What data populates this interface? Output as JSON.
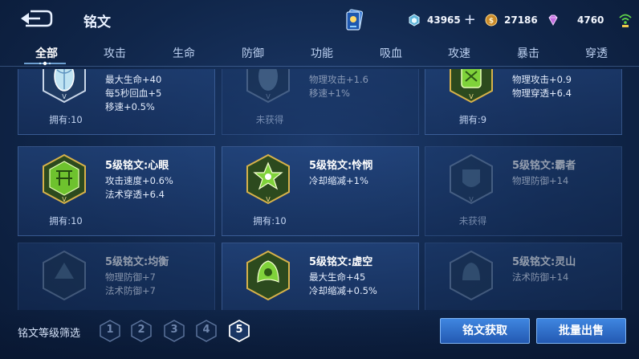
{
  "header": {
    "title": "铭文",
    "currency": [
      {
        "icon": "hex-coin-icon",
        "value": "43965"
      },
      {
        "icon": "gold-coin-icon",
        "value": "27186"
      },
      {
        "icon": "diamond-icon",
        "value": "4760"
      }
    ]
  },
  "tabs": [
    "全部",
    "攻击",
    "生命",
    "防御",
    "功能",
    "吸血",
    "攻速",
    "暴击",
    "穿透"
  ],
  "cards": [
    {
      "name": "",
      "stats": [
        "最大生命+40",
        "每5秒回血+5",
        "移速+0.5%"
      ],
      "owned": "拥有:10",
      "locked": false
    },
    {
      "name": "",
      "stats": [
        "物理攻击+1.6",
        "移速+1%",
        ""
      ],
      "owned": "未获得",
      "locked": true
    },
    {
      "name": "",
      "stats": [
        "物理攻击+0.9",
        "物理穿透+6.4",
        ""
      ],
      "owned": "拥有:9",
      "locked": false
    },
    {
      "name": "5级铭文:心眼",
      "stats": [
        "攻击速度+0.6%",
        "法术穿透+6.4",
        ""
      ],
      "owned": "拥有:10",
      "locked": false
    },
    {
      "name": "5级铭文:怜悯",
      "stats": [
        "冷却缩减+1%",
        "",
        ""
      ],
      "owned": "拥有:10",
      "locked": false
    },
    {
      "name": "5级铭文:霸者",
      "stats": [
        "物理防御+14",
        "",
        ""
      ],
      "owned": "未获得",
      "locked": true
    },
    {
      "name": "5级铭文:均衡",
      "stats": [
        "物理防御+7",
        "法术防御+7",
        ""
      ],
      "owned": "",
      "locked": true
    },
    {
      "name": "5级铭文:虚空",
      "stats": [
        "最大生命+45",
        "冷却缩减+0.5%",
        ""
      ],
      "owned": "",
      "locked": false
    },
    {
      "name": "5级铭文:灵山",
      "stats": [
        "法术防御+14",
        "",
        ""
      ],
      "owned": "",
      "locked": true
    }
  ],
  "footer": {
    "filter_label": "铭文等级筛选",
    "levels": [
      "1",
      "2",
      "3",
      "4",
      "5"
    ],
    "acquire_button": "铭文获取",
    "sell_button": "批量出售"
  },
  "colors": {
    "accent": "#2f6fcf",
    "active_tab": "#ffffff",
    "icon_green": "#7fd23a",
    "icon_gold": "#d7b24a"
  }
}
